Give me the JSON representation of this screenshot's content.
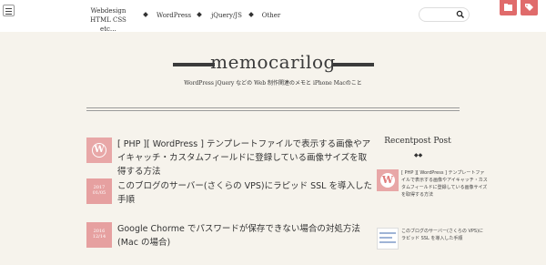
{
  "header": {
    "nav": [
      {
        "label_line1": "Webdesign",
        "label_line2": "HTML CSS etc…"
      },
      {
        "label": "WordPress"
      },
      {
        "label": "jQuery/JS"
      },
      {
        "label": "Other"
      }
    ],
    "search_placeholder": ""
  },
  "site": {
    "title": "memocarilog",
    "tagline": "WordPress jQuery などの Web 制作関連のメモと iPhone Macのこと"
  },
  "posts": [
    {
      "title": "[ PHP ][ WordPress ] テンプレートファイルで表示する画像やアイキャッチ・カスタムフィールドに登録している画像サイズを取得する方法",
      "thumb": "WordPress"
    },
    {
      "title": "このブログのサーバー(さくらの VPS)にラピッド SSL を導入した手順",
      "thumb_line1": "2017",
      "thumb_line2": "01/05"
    },
    {
      "title": "Google Chorme でパスワードが保存できない場合の対処方法(Mac の場合)",
      "thumb_line1": "2016",
      "thumb_line2": "12/14"
    }
  ],
  "sidebar": {
    "title": "Recentpost Post",
    "items": [
      {
        "text": "[ PHP ][ WordPress ] テンプレートファイルで表示する画像やアイキャッチ・カスタムフィールドに登録している画像サイズを取得する方法"
      },
      {
        "text": "このブログのサーバー(さくらの VPS)にラピッド SSL を導入した手順"
      }
    ]
  },
  "colors": {
    "background": "#f6f3ec",
    "accent": "#e06b6b",
    "title_bar": "#3b3b3b"
  }
}
